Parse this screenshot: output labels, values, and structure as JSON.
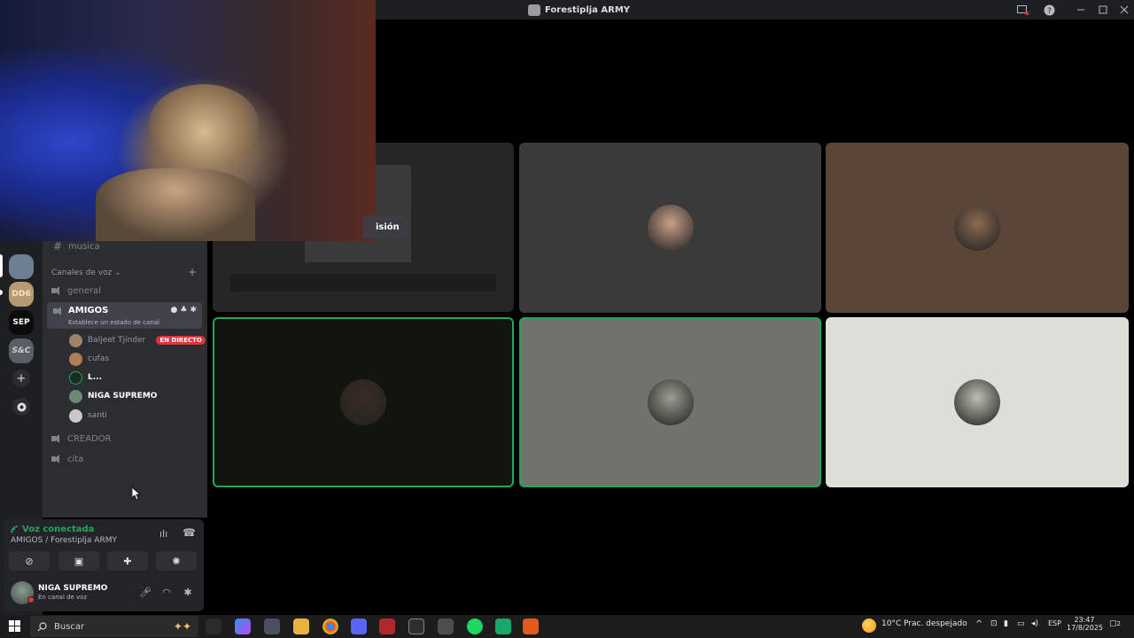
{
  "window": {
    "title": "Forestiplja ARMY"
  },
  "servers": [
    {
      "label": "",
      "color": "#6f7f93"
    },
    {
      "label": "DD6",
      "color": "#b89a72"
    },
    {
      "label": "SEP",
      "color": "#0b0b0b"
    },
    {
      "label": "S&C",
      "color": "#5a5f66"
    }
  ],
  "channels": {
    "text": {
      "name": "musica"
    },
    "voice_category": "Canales de voz",
    "general": "general",
    "amigos": {
      "name": "AMIGOS",
      "status": "Establece un estado de canal"
    },
    "members": [
      {
        "name": "Baljeet Tjinder",
        "live_badge": "EN DIRECTO",
        "avatar": "#a0846a"
      },
      {
        "name": "cufas",
        "avatar": "#b07f58"
      },
      {
        "name": "L...",
        "avatar": "#1d2a20"
      },
      {
        "name": "NIGA SUPREMO",
        "avatar": "#6c8a72"
      },
      {
        "name": "santi",
        "avatar": "#c9c9c9"
      }
    ],
    "creador": "CREADOR",
    "cita": "cita"
  },
  "voice_panel": {
    "connected_label": "Voz conectada",
    "location": "AMIGOS / Forestiplja ARMY",
    "user": {
      "name": "NIGA SUPREMO",
      "status": "En canal de voz"
    }
  },
  "stream": {
    "label_fragment": "isión"
  },
  "tiles": [
    {
      "bg": "#3b3a3b",
      "avatar": "#c9a08a"
    },
    {
      "bg": "#5a4536",
      "avatar": "#8c6a52"
    },
    {
      "bg": "#12140e",
      "avatar": "#3a2c22"
    },
    {
      "bg": "#72726c",
      "avatar": "#9c9c92"
    },
    {
      "bg": "#dcdfd7",
      "avatar": "#b9c0b2"
    }
  ],
  "taskbar": {
    "search_placeholder": "Buscar",
    "weather": "10°C",
    "weather_desc": "Prac. despejado",
    "lang": "ESP",
    "time": "23:47",
    "date": "17/8/2025",
    "notifications": "2"
  },
  "colors": {
    "accent_green": "#23a55a",
    "live_red": "#da373c"
  }
}
